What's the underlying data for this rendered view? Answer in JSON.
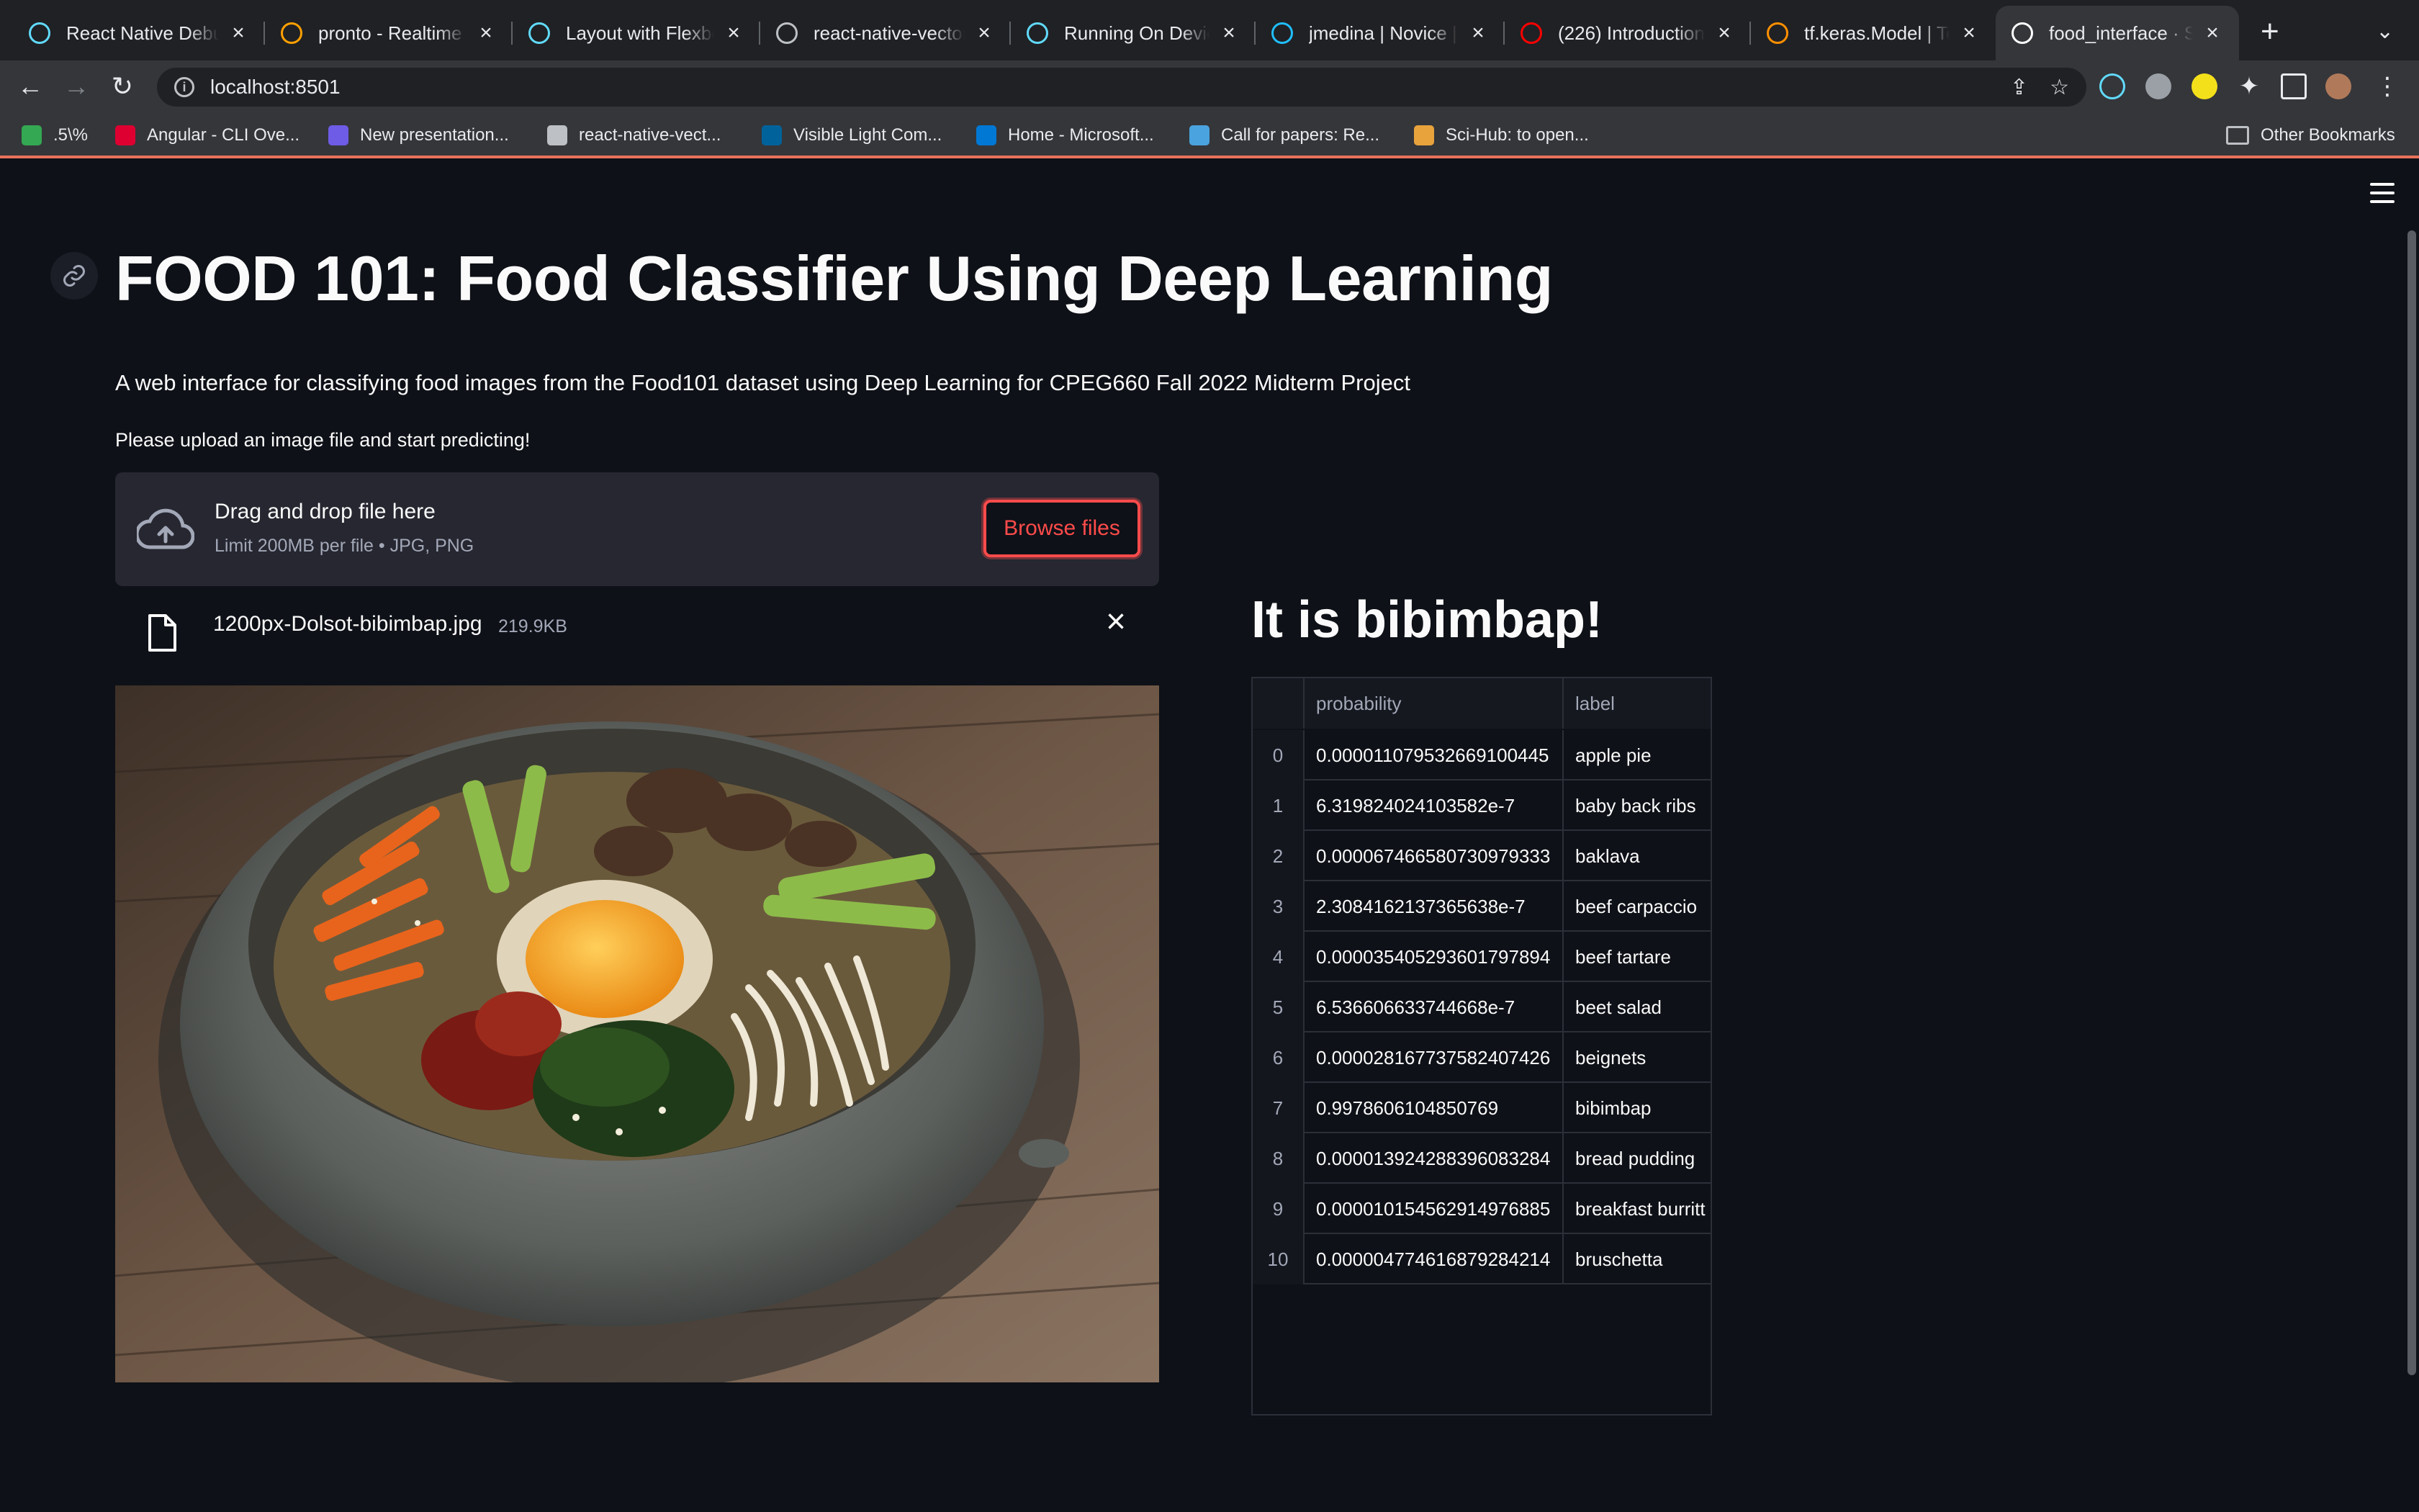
{
  "browser": {
    "tabs": [
      {
        "label": "React Native Debugger",
        "icon": "react-icon",
        "color": "#61dafb"
      },
      {
        "label": "pronto - Realtime Dashboard",
        "icon": "firebase-icon",
        "color": "#ffa000"
      },
      {
        "label": "Layout with Flexbox",
        "icon": "react-icon",
        "color": "#61dafb"
      },
      {
        "label": "react-native-vector-icons",
        "icon": "globe-icon",
        "color": "#bdc1c6"
      },
      {
        "label": "Running On Device",
        "icon": "react-icon",
        "color": "#61dafb"
      },
      {
        "label": "jmedina | Novice | Kaggle",
        "icon": "kaggle-icon",
        "color": "#20beff"
      },
      {
        "label": "(226) Introduction",
        "icon": "youtube-icon",
        "color": "#ff0000"
      },
      {
        "label": "tf.keras.Model  |  TensorFlow",
        "icon": "tensorflow-icon",
        "color": "#ff8f00"
      },
      {
        "label": "food_interface · Streamlit",
        "icon": "streamlit-icon",
        "color": "#ffffff",
        "active": true
      }
    ],
    "url": "localhost:8501",
    "bookmarks": [
      {
        "label": ".5\\%",
        "icon": "sprout-icon",
        "color": "#34a853"
      },
      {
        "label": "Angular - CLI Ove...",
        "icon": "angular-icon",
        "color": "#dd0031"
      },
      {
        "label": "New presentation...",
        "icon": "presentation-icon",
        "color": "#6e5ce6"
      },
      {
        "label": "react-native-vect...",
        "icon": "globe-icon",
        "color": "#bdc1c6"
      },
      {
        "label": "Visible Light Com...",
        "icon": "ieee-icon",
        "color": "#00629b"
      },
      {
        "label": "Home - Microsoft...",
        "icon": "azure-icon",
        "color": "#0078d4"
      },
      {
        "label": "Call for papers: Re...",
        "icon": "link-icon",
        "color": "#4aa3df"
      },
      {
        "label": "Sci-Hub: to open...",
        "icon": "scihub-icon",
        "color": "#e8a33c"
      }
    ],
    "other_bookmarks": "Other Bookmarks"
  },
  "app": {
    "title": "FOOD 101: Food Classifier Using Deep Learning",
    "subtitle": "A web interface for classifying food images from the Food101 dataset using Deep Learning for CPEG660 Fall 2022 Midterm Project",
    "upload_prompt": "Please upload an image file and start predicting!",
    "dropzone": {
      "main": "Drag and drop file here",
      "sub": "Limit 200MB per file • JPG, PNG",
      "browse_label": "Browse files"
    },
    "file": {
      "name": "1200px-Dolsot-bibimbap.jpg",
      "size": "219.9KB"
    },
    "result": "It is bibimbap!",
    "table": {
      "columns": [
        "",
        "probability",
        "label"
      ],
      "rows": [
        [
          "0",
          "0.000011079532669100445",
          "apple pie"
        ],
        [
          "1",
          "6.319824024103582e-7",
          "baby back ribs"
        ],
        [
          "2",
          "0.000067466580730979333",
          "baklava"
        ],
        [
          "3",
          "2.3084162137365638e-7",
          "beef carpaccio"
        ],
        [
          "4",
          "0.000035405293601797894",
          "beef tartare"
        ],
        [
          "5",
          "6.536606633744668e-7",
          "beet salad"
        ],
        [
          "6",
          "0.000028167737582407426",
          "beignets"
        ],
        [
          "7",
          "0.9978606104850769",
          "bibimbap"
        ],
        [
          "8",
          "0.000013924288396083284",
          "bread pudding"
        ],
        [
          "9",
          "0.000010154562914976885",
          "breakfast burritt"
        ],
        [
          "10",
          "0.000004774616879284214",
          "bruschetta"
        ]
      ]
    }
  },
  "colors": {
    "accent": "#ff4b4b",
    "background": "#0e1117",
    "dropzone": "#262730"
  }
}
